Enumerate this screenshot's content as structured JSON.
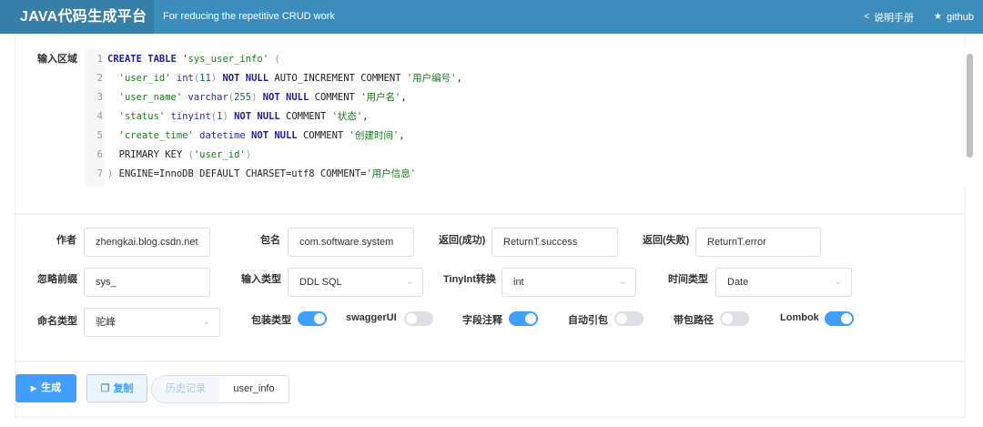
{
  "header": {
    "brand": "JAVA代码生成平台",
    "tagline": "For reducing the repetitive CRUD work",
    "manual_label": "说明手册",
    "github_label": "github"
  },
  "input": {
    "label": "输入区域",
    "lines": [
      {
        "n": "1",
        "segs": [
          {
            "t": "CREATE TABLE ",
            "c": "kw"
          },
          {
            "t": "'sys_user_info'",
            "c": "str"
          },
          {
            "t": " (",
            "c": "paren"
          }
        ]
      },
      {
        "n": "2",
        "segs": [
          {
            "t": "  'user_id'",
            "c": "str"
          },
          {
            "t": " int",
            "c": "typ"
          },
          {
            "t": "(",
            "c": "paren"
          },
          {
            "t": "11",
            "c": "num"
          },
          {
            "t": ")",
            "c": "paren"
          },
          {
            "t": " NOT NULL",
            "c": "kw"
          },
          {
            "t": " AUTO_INCREMENT COMMENT ",
            "c": ""
          },
          {
            "t": "'用户编号'",
            "c": "str"
          },
          {
            "t": ",",
            "c": ""
          }
        ]
      },
      {
        "n": "3",
        "segs": [
          {
            "t": "  'user_name'",
            "c": "str"
          },
          {
            "t": " varchar",
            "c": "typ"
          },
          {
            "t": "(",
            "c": "paren"
          },
          {
            "t": "255",
            "c": "num"
          },
          {
            "t": ")",
            "c": "paren"
          },
          {
            "t": " NOT NULL",
            "c": "kw"
          },
          {
            "t": " COMMENT ",
            "c": ""
          },
          {
            "t": "'用户名'",
            "c": "str"
          },
          {
            "t": ",",
            "c": ""
          }
        ]
      },
      {
        "n": "4",
        "segs": [
          {
            "t": "  'status'",
            "c": "str"
          },
          {
            "t": " tinyint",
            "c": "typ"
          },
          {
            "t": "(",
            "c": "paren"
          },
          {
            "t": "1",
            "c": "num"
          },
          {
            "t": ")",
            "c": "paren"
          },
          {
            "t": " NOT NULL",
            "c": "kw"
          },
          {
            "t": " COMMENT ",
            "c": ""
          },
          {
            "t": "'状态'",
            "c": "str"
          },
          {
            "t": ",",
            "c": ""
          }
        ]
      },
      {
        "n": "5",
        "segs": [
          {
            "t": "  'create_time'",
            "c": "str"
          },
          {
            "t": " datetime",
            "c": "typ"
          },
          {
            "t": " NOT NULL",
            "c": "kw"
          },
          {
            "t": " COMMENT ",
            "c": ""
          },
          {
            "t": "'创建时间'",
            "c": "str"
          },
          {
            "t": ",",
            "c": ""
          }
        ]
      },
      {
        "n": "6",
        "segs": [
          {
            "t": "  PRIMARY KEY ",
            "c": ""
          },
          {
            "t": "(",
            "c": "paren"
          },
          {
            "t": "'user_id'",
            "c": "str"
          },
          {
            "t": ")",
            "c": "paren"
          }
        ]
      },
      {
        "n": "7",
        "segs": [
          {
            "t": ")",
            "c": "paren"
          },
          {
            "t": " ENGINE=InnoDB DEFAULT CHARSET=utf8 COMMENT=",
            "c": ""
          },
          {
            "t": "'用户信息'",
            "c": "str"
          }
        ]
      }
    ]
  },
  "config": {
    "author_label": "作者",
    "author_value": "zhengkai.blog.csdn.net",
    "package_label": "包名",
    "package_value": "com.software.system",
    "success_label": "返回(成功)",
    "success_value": "ReturnT.success",
    "fail_label": "返回(失败)",
    "fail_value": "ReturnT.error",
    "prefix_label": "忽略前缀",
    "prefix_value": "sys_",
    "input_type_label": "输入类型",
    "input_type_value": "DDL SQL",
    "tinyint_label": "TinyInt转换",
    "tinyint_value": "int",
    "time_type_label": "时间类型",
    "time_type_value": "Date",
    "naming_label": "命名类型",
    "naming_value": "驼峰",
    "toggles": [
      {
        "label": "包装类型",
        "on": true
      },
      {
        "label": "swaggerUI",
        "on": false
      },
      {
        "label": "字段注释",
        "on": true
      },
      {
        "label": "自动引包",
        "on": false
      },
      {
        "label": "带包路径",
        "on": false
      },
      {
        "label": "Lombok",
        "on": true
      }
    ]
  },
  "actions": {
    "generate_label": "生成",
    "copy_label": "复制",
    "history_label": "历史记录",
    "history_item": "user_info"
  },
  "colors": {
    "header": "#3c8dbc",
    "brand_bg": "#367fa9",
    "primary": "#409eff"
  }
}
